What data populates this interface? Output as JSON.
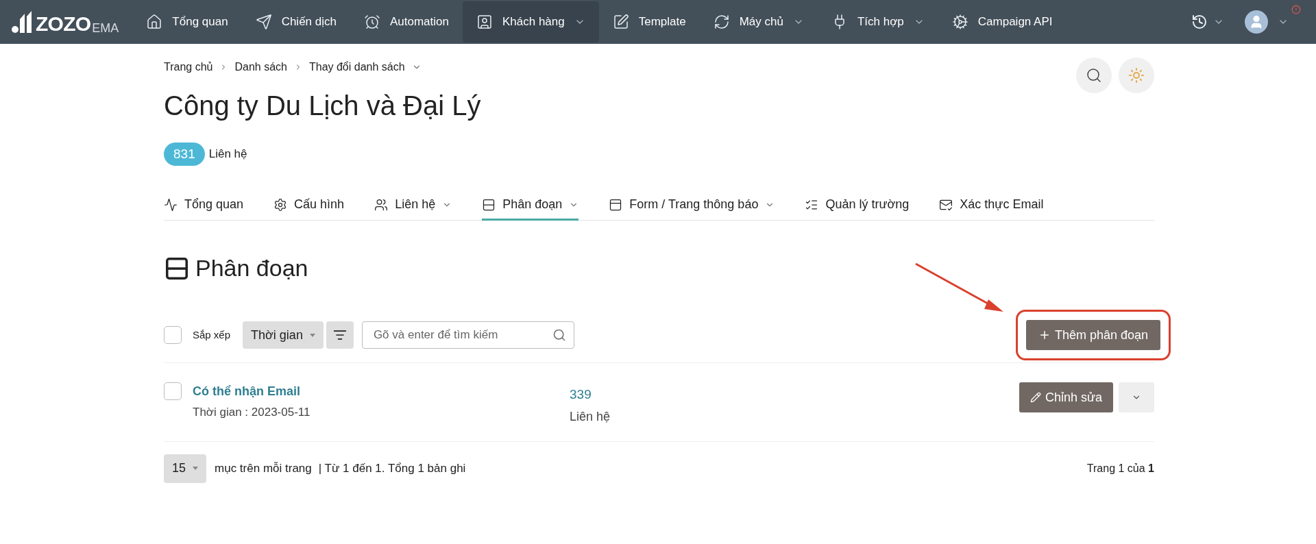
{
  "nav": {
    "logo": {
      "brand": "ZOZO",
      "suffix": "EMA"
    },
    "items": [
      {
        "label": "Tổng quan",
        "dropdown": false,
        "selected": false
      },
      {
        "label": "Chiến dịch",
        "dropdown": false,
        "selected": false
      },
      {
        "label": "Automation",
        "dropdown": false,
        "selected": false
      },
      {
        "label": "Khách hàng",
        "dropdown": true,
        "selected": true
      },
      {
        "label": "Template",
        "dropdown": false,
        "selected": false
      },
      {
        "label": "Máy chủ",
        "dropdown": true,
        "selected": false
      },
      {
        "label": "Tích hợp",
        "dropdown": true,
        "selected": false
      },
      {
        "label": "Campaign API",
        "dropdown": false,
        "selected": false
      }
    ],
    "alert": true
  },
  "breadcrumb": [
    {
      "label": "Trang chủ",
      "dropdown": false
    },
    {
      "label": "Danh sách",
      "dropdown": false
    },
    {
      "label": "Thay đổi danh sách",
      "dropdown": true
    }
  ],
  "title": "Công ty Du Lịch và Đại Lý",
  "contacts": {
    "count": "831",
    "label": "Liên hệ"
  },
  "tabs": [
    {
      "label": "Tổng quan",
      "dropdown": false,
      "selected": false
    },
    {
      "label": "Cấu hình",
      "dropdown": false,
      "selected": false
    },
    {
      "label": "Liên hệ",
      "dropdown": true,
      "selected": false
    },
    {
      "label": "Phân đoạn",
      "dropdown": true,
      "selected": true
    },
    {
      "label": "Form / Trang thông báo",
      "dropdown": true,
      "selected": false
    },
    {
      "label": "Quản lý trường",
      "dropdown": false,
      "selected": false
    },
    {
      "label": "Xác thực Email",
      "dropdown": false,
      "selected": false
    }
  ],
  "section": {
    "title": "Phân đoạn"
  },
  "toolbar": {
    "select_all": {
      "checked": false
    },
    "sort_label": "Sắp xếp",
    "sort_select": "Thời gian",
    "search": {
      "placeholder": "Gõ và enter để tìm kiếm"
    },
    "add_button": "Thêm phân đoạn"
  },
  "rows": [
    {
      "name": "Có thể nhận Email",
      "date": "Thời gian : 2023-05-11",
      "count": "339",
      "count_label": "Liên hệ",
      "edit_button": "Chỉnh sửa",
      "checked": false
    }
  ],
  "pagination": {
    "per_page": "15",
    "per_page_label": "mục trên mỗi trang",
    "range": "| Từ 1 đến 1. Tổng 1 bản ghi",
    "page": "Trang 1 của **1**"
  }
}
